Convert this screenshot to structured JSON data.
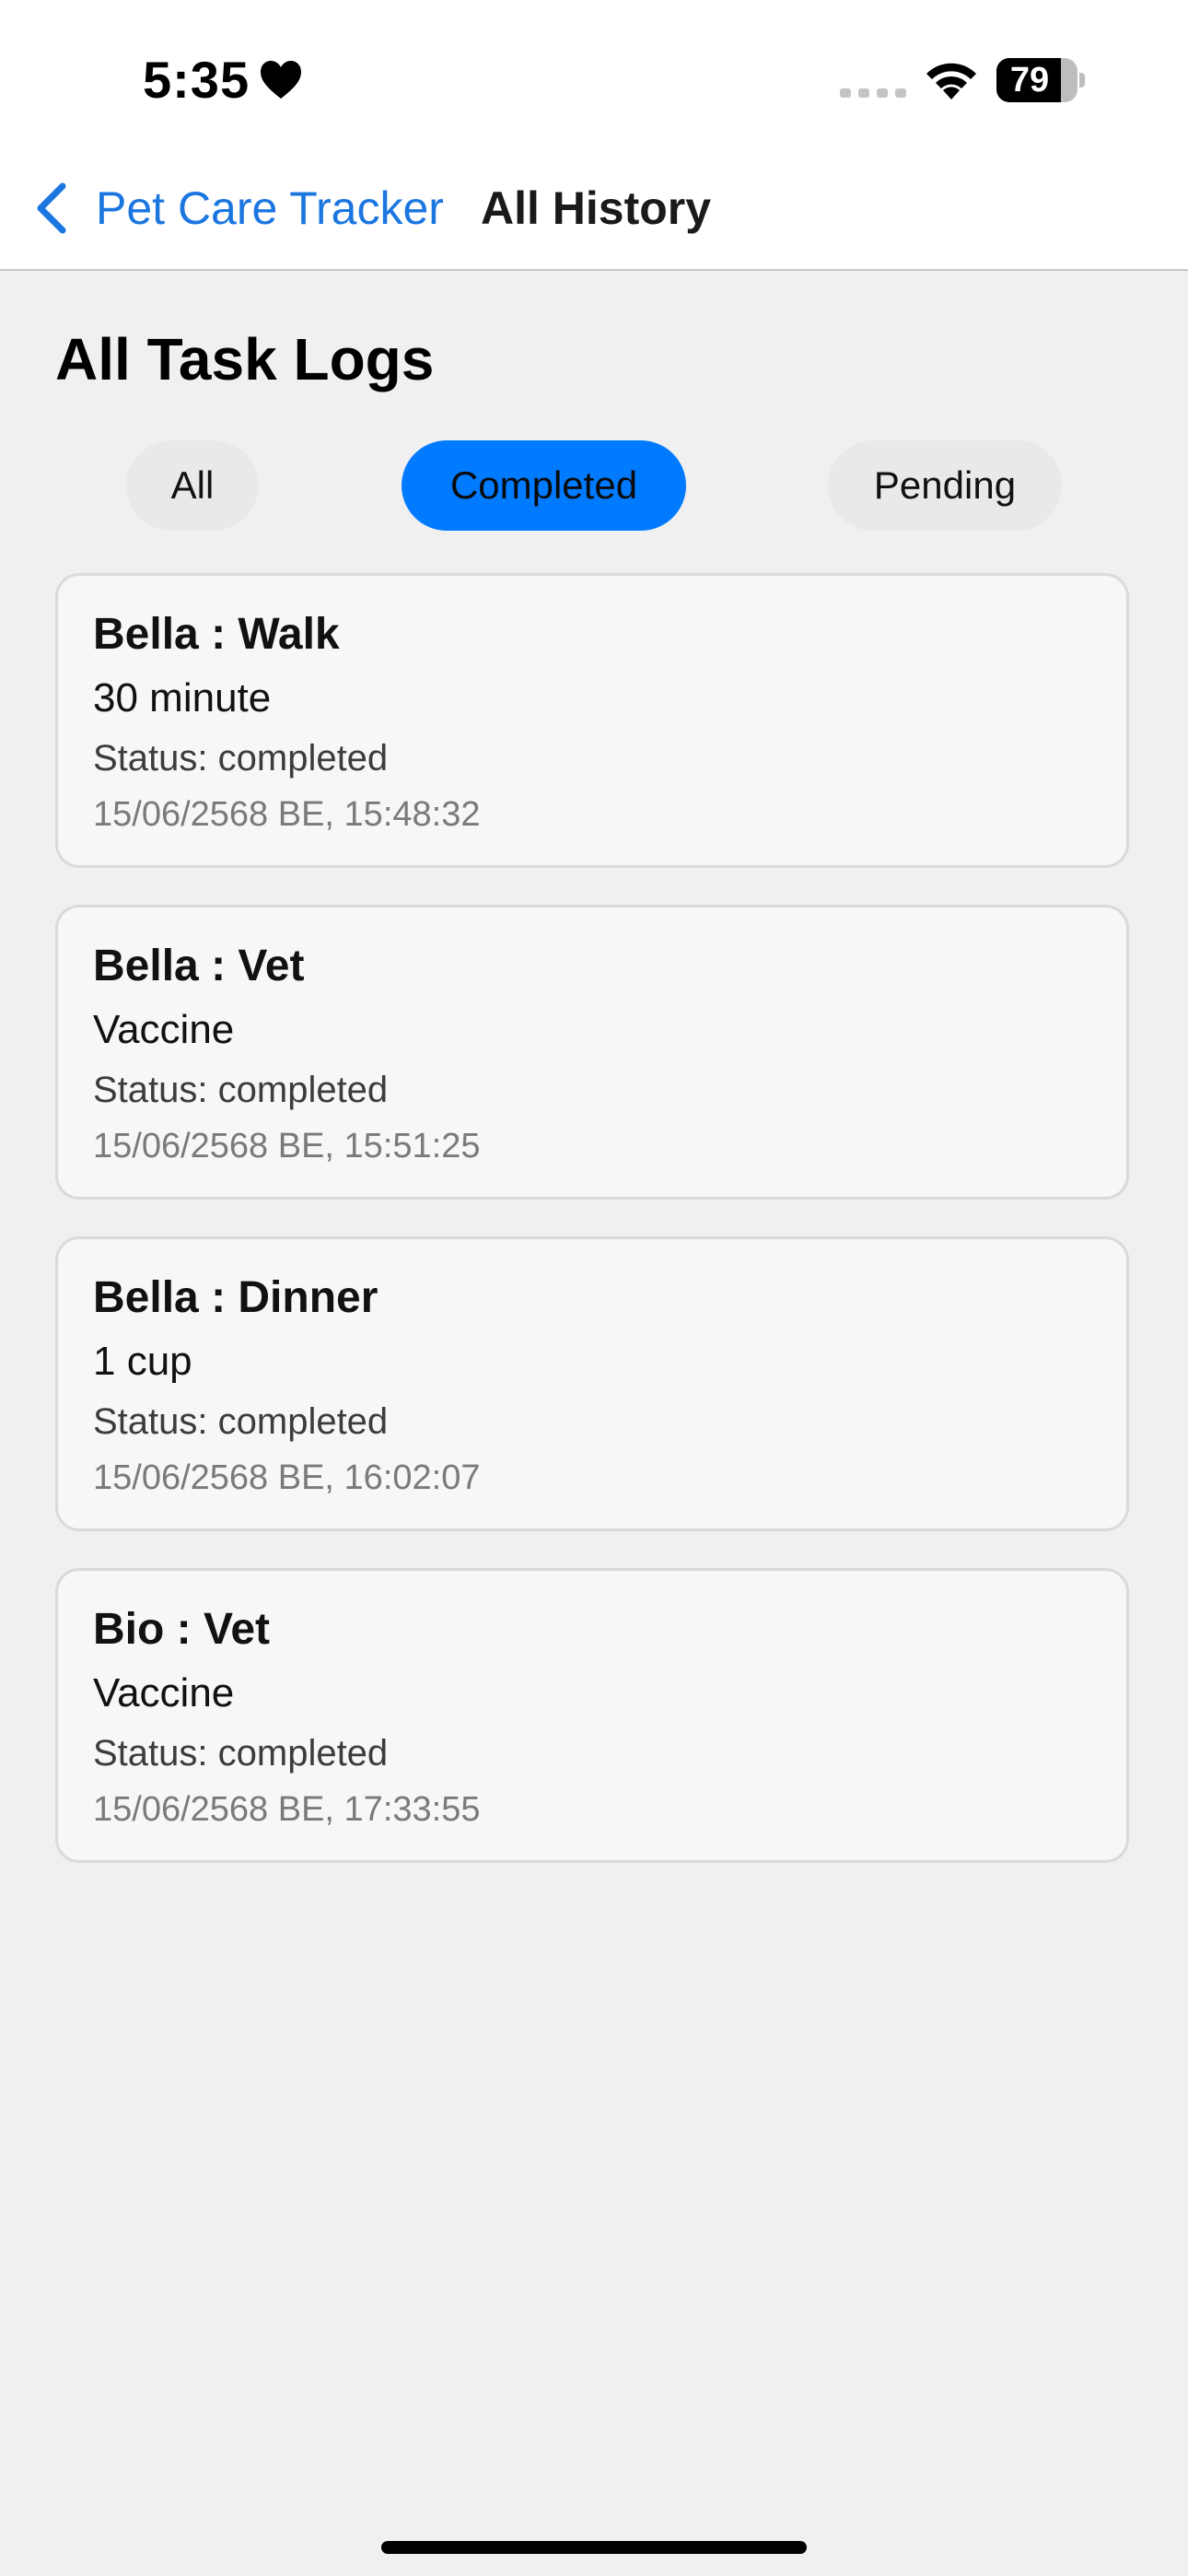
{
  "status_bar": {
    "time": "5:35",
    "battery_level": "79",
    "battery_fraction": 0.79,
    "icons": [
      "heart-icon",
      "signal-icon",
      "wifi-icon",
      "battery-icon"
    ]
  },
  "nav": {
    "back_label": "Pet Care Tracker",
    "title": "All History",
    "back_icon": "chevron-left-icon"
  },
  "page": {
    "title": "All Task Logs"
  },
  "filters": {
    "all": "All",
    "completed": "Completed",
    "pending": "Pending",
    "selected": "Completed"
  },
  "logs": [
    {
      "title": "Bella : Walk",
      "detail": "30 minute",
      "status": "Status: completed",
      "timestamp": "15/06/2568 BE, 15:48:32"
    },
    {
      "title": "Bella : Vet",
      "detail": "Vaccine",
      "status": "Status: completed",
      "timestamp": "15/06/2568 BE, 15:51:25"
    },
    {
      "title": "Bella : Dinner",
      "detail": "1 cup",
      "status": "Status: completed",
      "timestamp": "15/06/2568 BE, 16:02:07"
    },
    {
      "title": "Bio : Vet",
      "detail": "Vaccine",
      "status": "Status: completed",
      "timestamp": "15/06/2568 BE, 17:33:55"
    }
  ],
  "colors": {
    "accent": "#007aff",
    "link": "#1b76e0",
    "background": "#f0f0f0",
    "card": "#f7f7f7"
  }
}
